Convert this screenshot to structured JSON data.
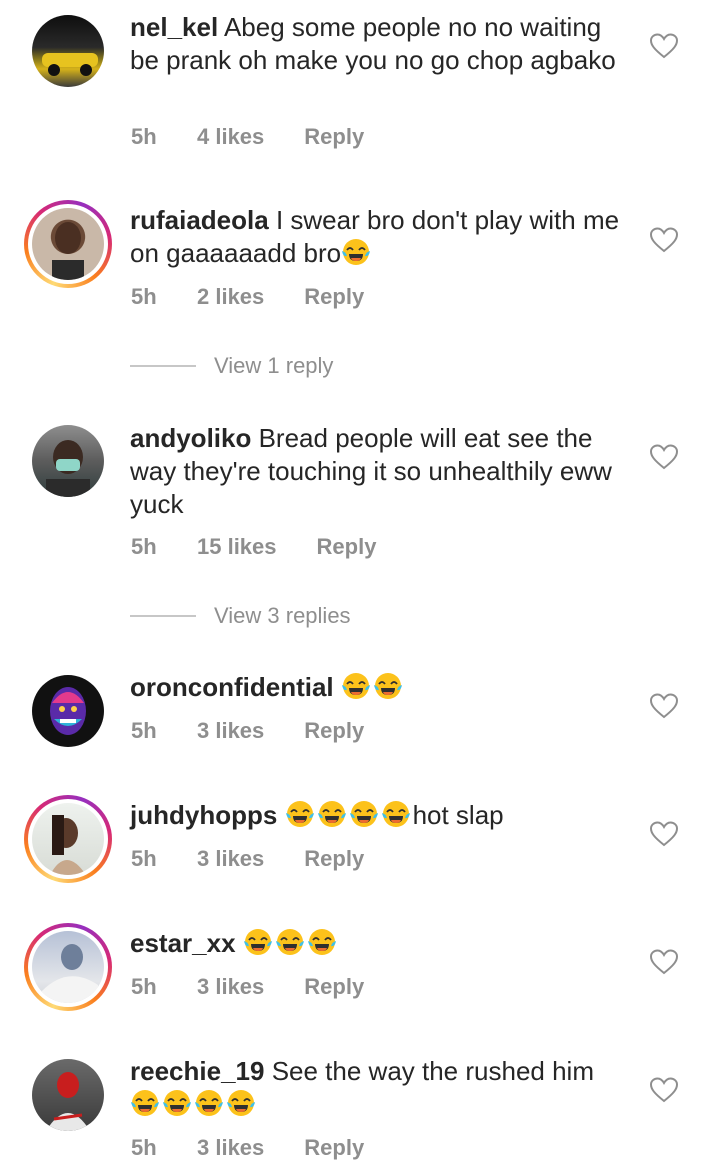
{
  "comments": [
    {
      "username": "nel_kel",
      "text": "Abeg some people no no waiting be prank oh make you no go chop agbako",
      "time": "5h",
      "likes": "4 likes",
      "reply": "Reply",
      "emoji": 0
    },
    {
      "username": "rufaiadeola",
      "text": "I swear bro don't play with me on gaaaaaadd bro",
      "time": "5h",
      "likes": "2 likes",
      "reply": "Reply",
      "emoji": 1
    },
    {
      "username": "andyoliko",
      "text": "Bread people will eat see the way they're touching it so unhealthily eww yuck",
      "time": "5h",
      "likes": "15 likes",
      "reply": "Reply",
      "emoji": 0
    },
    {
      "username": "oronconfidential",
      "text": "",
      "time": "5h",
      "likes": "3 likes",
      "reply": "Reply",
      "emoji": 2
    },
    {
      "username": "juhdyhopps",
      "text": "hot slap",
      "time": "5h",
      "likes": "3 likes",
      "reply": "Reply",
      "emoji": 4
    },
    {
      "username": "estar_xx",
      "text": "",
      "time": "5h",
      "likes": "3 likes",
      "reply": "Reply",
      "emoji": 3
    },
    {
      "username": "reechie_19",
      "text": "See the way the rushed him",
      "time": "5h",
      "likes": "3 likes",
      "reply": "Reply",
      "emoji": 4
    }
  ],
  "view_replies": [
    {
      "label": "View 1 reply"
    },
    {
      "label": "View 3 replies"
    }
  ],
  "icons": {
    "like": "heart-outline-icon",
    "emoji": "face-with-tears-of-joy-emoji"
  },
  "colors": {
    "username": "#262626",
    "meta": "#8e8e8e",
    "story_ring": "#d62976"
  }
}
